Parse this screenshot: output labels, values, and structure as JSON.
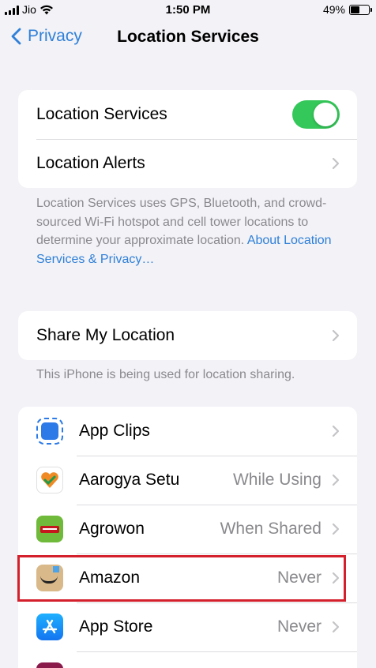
{
  "status_bar": {
    "carrier": "Jio",
    "time": "1:50 PM",
    "battery": "49%",
    "battery_level": 0.49
  },
  "nav": {
    "back_label": "Privacy",
    "title": "Location Services"
  },
  "main_group": {
    "location_services_label": "Location Services",
    "location_services_on": true,
    "location_alerts_label": "Location Alerts"
  },
  "footnote": {
    "text": "Location Services uses GPS, Bluetooth, and crowd-sourced Wi-Fi hotspot and cell tower locations to determine your approximate location.",
    "link": "About Location Services & Privacy…"
  },
  "share": {
    "label": "Share My Location",
    "note": "This iPhone is being used for location sharing."
  },
  "apps": [
    {
      "name": "App Clips",
      "value": "",
      "icon": "app-clips-icon"
    },
    {
      "name": "Aarogya Setu",
      "value": "While Using",
      "icon": "aarogya-setu-icon"
    },
    {
      "name": "Agrowon",
      "value": "When Shared",
      "icon": "agrowon-icon"
    },
    {
      "name": "Amazon",
      "value": "Never",
      "icon": "amazon-icon"
    },
    {
      "name": "App Store",
      "value": "Never",
      "icon": "app-store-icon"
    }
  ],
  "colors": {
    "accent": "#2f80d8",
    "toggle_on": "#34c759",
    "highlight": "#d4202c"
  }
}
